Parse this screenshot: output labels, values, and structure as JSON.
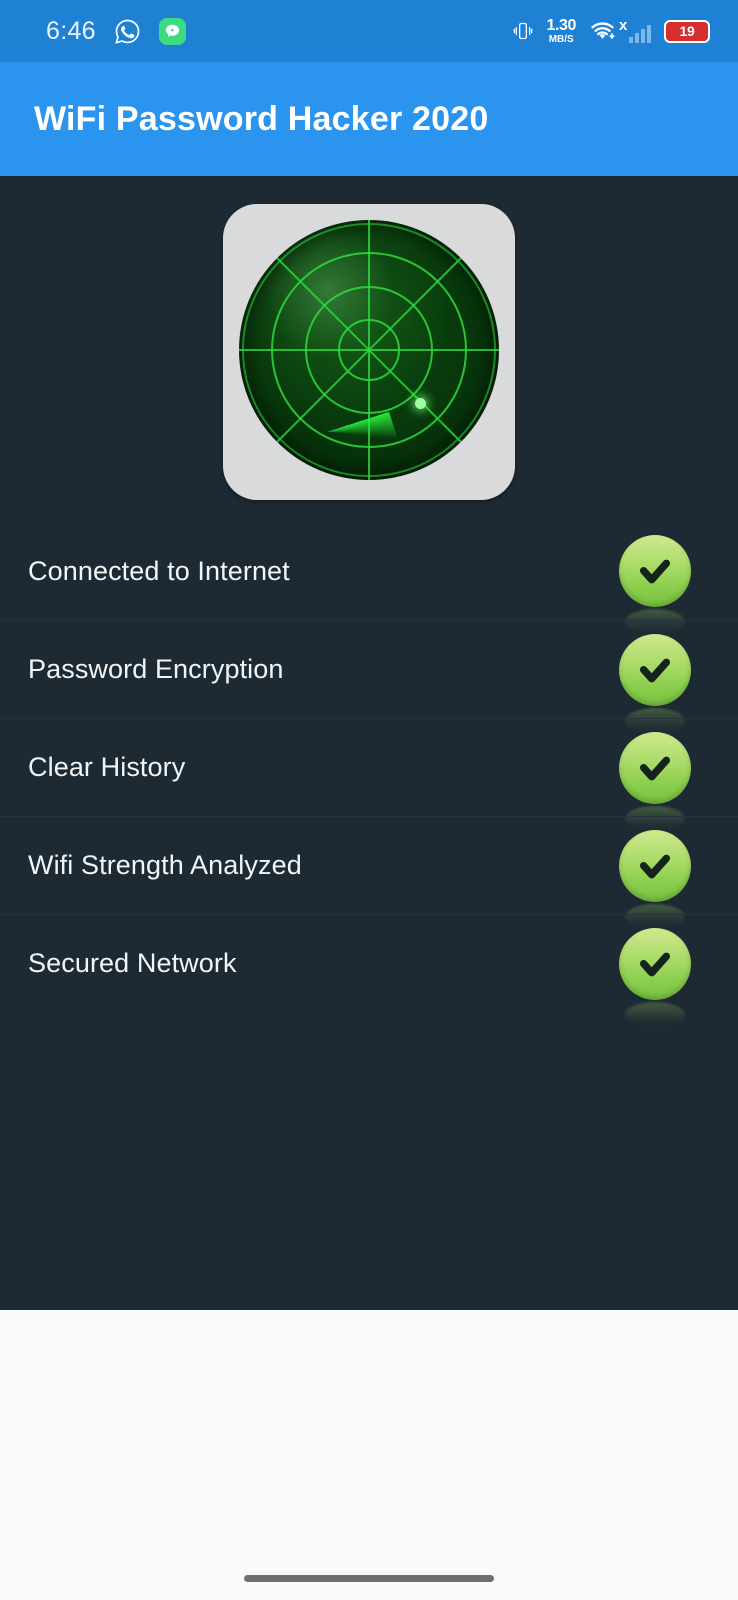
{
  "status_bar": {
    "clock": "6:46",
    "whatsapp_icon": "whatsapp-icon",
    "message_icon": "message-icon",
    "vibrate_icon": "vibrate-icon",
    "network_speed_value": "1.30",
    "network_speed_unit": "MB/S",
    "wifi_icon": "wifi-icon",
    "signal_blocked_marker": "x",
    "signal_icon": "cellular-signal-icon",
    "battery_level": "19",
    "background_color": "#1f81d4"
  },
  "app_bar": {
    "title": "WiFi Password Hacker 2020",
    "background_color": "#2b94ef",
    "title_color": "#ffffff"
  },
  "content": {
    "background_color": "#1e2a33",
    "radar_image": "radar-scope-image",
    "radar_accent_color": "#2edc3e"
  },
  "status_list": {
    "check_color": "#8ccf4e",
    "items": [
      {
        "label": "Connected to Internet",
        "status_icon": "check-circle-icon",
        "checked": true
      },
      {
        "label": "Password Encryption",
        "status_icon": "check-circle-icon",
        "checked": true
      },
      {
        "label": "Clear History",
        "status_icon": "check-circle-icon",
        "checked": true
      },
      {
        "label": "Wifi Strength Analyzed",
        "status_icon": "check-circle-icon",
        "checked": true
      },
      {
        "label": "Secured Network",
        "status_icon": "check-circle-icon",
        "checked": true
      }
    ]
  },
  "bottom_area": {
    "background_color": "#fafafa",
    "nav_pill": "gesture-navigation-pill"
  }
}
